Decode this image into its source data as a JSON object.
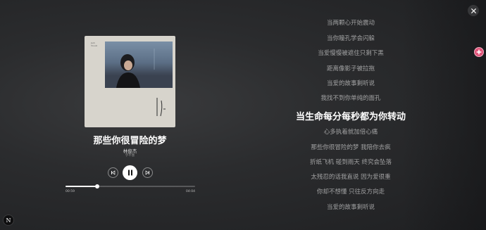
{
  "window": {
    "close_icon": "close-icon",
    "badge_icon": "flower-icon",
    "corner_logo_text": "N"
  },
  "album": {
    "cover_small_text_line1": "Jack",
    "cover_small_text_line2": "Yosuki",
    "title": "那些你很冒险的梦",
    "artist": "林俊杰",
    "album_name": "学不会"
  },
  "controls": {
    "prev_icon": "skip-previous-icon",
    "play_icon": "pause-icon",
    "next_icon": "skip-next-icon"
  },
  "progress": {
    "current_time": "00:59",
    "total_time": "04:04",
    "fraction": 0.242
  },
  "lyrics": {
    "active_index": 7,
    "lines": [
      "当两颗心开始震动",
      "当你瞳孔学会闪躲",
      "当爱慢慢被遮住只剩下黑",
      "距离像影子被拉拖",
      "当爱的故事剩听说",
      "我找不到你单纯的面孔",
      "当生命每分每秒都为你转动",
      "心多执着就加倍心痛",
      "那些你很冒险的梦 我陪你去疯",
      "折纸飞机 碰到雨天 终究会坠落",
      "太残忍的话我直说 因为爱很重",
      "你却不想懂 只往反方向走",
      "当爱的故事剩听说"
    ]
  }
}
